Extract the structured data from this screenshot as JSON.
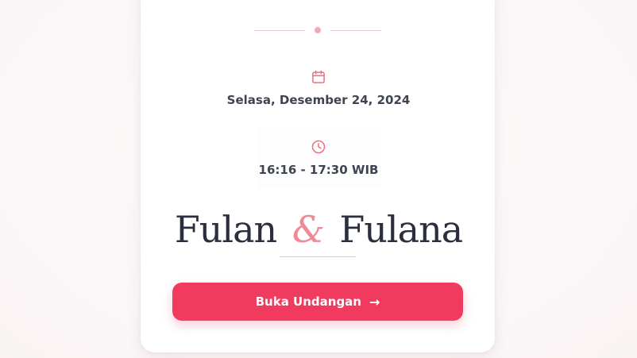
{
  "event": {
    "date_text": "Selasa, Desember 24, 2024",
    "time_text": "16:16 - 17:30 WIB"
  },
  "couple": {
    "groom": "Fulan",
    "ampersand": "&",
    "bride": "Fulana"
  },
  "cta": {
    "label": "Buka Undangan",
    "arrow": "→"
  },
  "icons": {
    "date": "calendar-icon",
    "time": "clock-icon"
  },
  "colors": {
    "accent": "#f03b5e",
    "accent_soft": "#f08a97",
    "text_dark": "#2a2e3d",
    "text_body": "#3f4452",
    "card_bg": "#ffffff"
  }
}
